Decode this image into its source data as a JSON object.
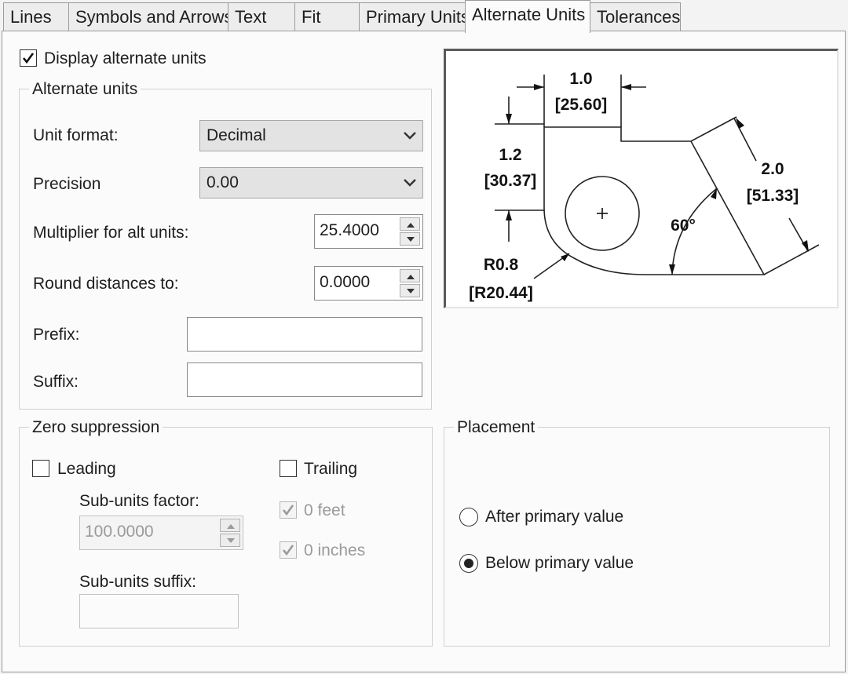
{
  "tabs": [
    {
      "label": "Lines"
    },
    {
      "label": "Symbols and Arrows"
    },
    {
      "label": "Text"
    },
    {
      "label": "Fit"
    },
    {
      "label": "Primary Units"
    },
    {
      "label": "Alternate Units"
    },
    {
      "label": "Tolerances"
    }
  ],
  "display_alt": {
    "label": "Display alternate units",
    "checked": true
  },
  "alt_units": {
    "title": "Alternate units",
    "unit_format": {
      "label": "Unit format:",
      "value": "Decimal"
    },
    "precision": {
      "label": "Precision",
      "value": "0.00"
    },
    "multiplier": {
      "label": "Multiplier for alt units:",
      "value": "25.4000"
    },
    "round": {
      "label": "Round distances  to:",
      "value": "0.0000"
    },
    "prefix": {
      "label": "Prefix:",
      "value": ""
    },
    "suffix": {
      "label": "Suffix:",
      "value": ""
    }
  },
  "zero_suppression": {
    "title": "Zero suppression",
    "leading": {
      "label": "Leading",
      "checked": false
    },
    "trailing": {
      "label": "Trailing",
      "checked": false
    },
    "subunits_factor": {
      "label": "Sub-units factor:",
      "value": "100.0000"
    },
    "subunits_suffix": {
      "label": "Sub-units suffix:",
      "value": ""
    },
    "zero_feet": {
      "label": "0 feet",
      "checked": true
    },
    "zero_inches": {
      "label": "0 inches",
      "checked": true
    }
  },
  "placement": {
    "title": "Placement",
    "after": {
      "label": "After primary value",
      "selected": false
    },
    "below": {
      "label": "Below primary value",
      "selected": true
    }
  },
  "preview": {
    "dim_top": "1.0",
    "dim_top_alt": "[25.60]",
    "dim_left": "1.2",
    "dim_left_alt": "[30.37]",
    "dim_right": "2.0",
    "dim_right_alt": "[51.33]",
    "angle": "60°",
    "radius": "R0.8",
    "radius_alt": "[R20.44]"
  }
}
